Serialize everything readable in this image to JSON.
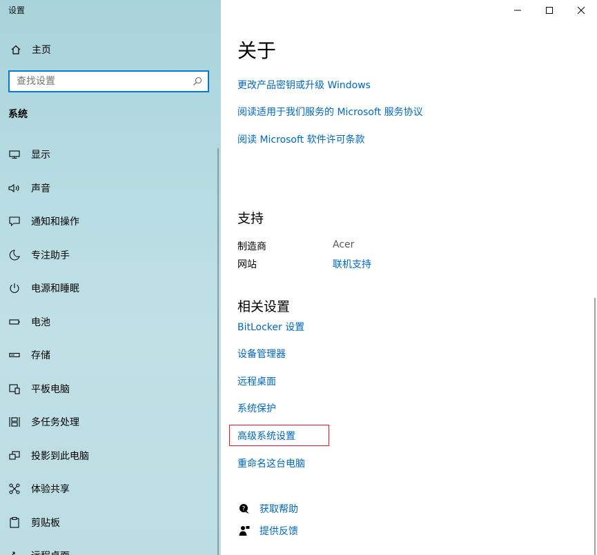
{
  "app_title": "设置",
  "sidebar": {
    "home_label": "主页",
    "search_placeholder": "查找设置",
    "section_title": "系统",
    "items": [
      {
        "label": "显示",
        "icon": "monitor-icon"
      },
      {
        "label": "声音",
        "icon": "speaker-icon"
      },
      {
        "label": "通知和操作",
        "icon": "notification-icon"
      },
      {
        "label": "专注助手",
        "icon": "moon-icon"
      },
      {
        "label": "电源和睡眠",
        "icon": "power-icon"
      },
      {
        "label": "电池",
        "icon": "battery-icon"
      },
      {
        "label": "存储",
        "icon": "storage-icon"
      },
      {
        "label": "平板电脑",
        "icon": "tablet-icon"
      },
      {
        "label": "多任务处理",
        "icon": "multitask-icon"
      },
      {
        "label": "投影到此电脑",
        "icon": "project-icon"
      },
      {
        "label": "体验共享",
        "icon": "share-icon"
      },
      {
        "label": "剪贴板",
        "icon": "clipboard-icon"
      },
      {
        "label": "远程桌面",
        "icon": "remote-desktop-icon"
      }
    ]
  },
  "main": {
    "title": "关于",
    "about_links": [
      "更改产品密钥或升级 Windows",
      "阅读适用于我们服务的 Microsoft 服务协议",
      "阅读 Microsoft 软件许可条款"
    ],
    "support_title": "支持",
    "support": {
      "manufacturer_label": "制造商",
      "manufacturer_value": "Acer",
      "website_label": "网站",
      "website_value": "联机支持"
    },
    "related_title": "相关设置",
    "related_links": [
      "BitLocker 设置",
      "设备管理器",
      "远程桌面",
      "系统保护",
      "高级系统设置",
      "重命名这台电脑"
    ],
    "help": {
      "get_help": "获取帮助",
      "feedback": "提供反馈"
    }
  },
  "colors": {
    "accent": "#0067c0",
    "highlight_border": "#e0141c",
    "sidebar_bg": "#b5dbe2"
  }
}
